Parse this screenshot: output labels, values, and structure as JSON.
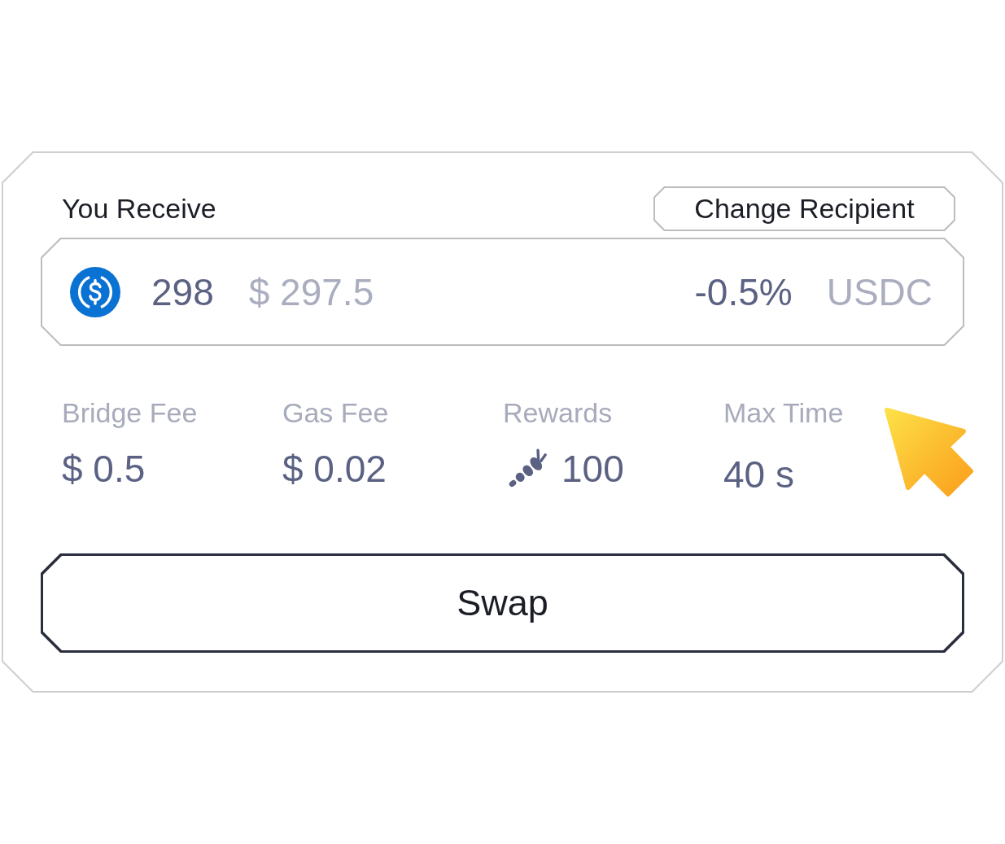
{
  "receive": {
    "label": "You Receive",
    "change_recipient_button": "Change Recipient",
    "amount": "298",
    "usd_value": "$ 297.5",
    "price_impact": "-0.5%",
    "token": "USDC"
  },
  "stats": [
    {
      "kind": "money",
      "label": "Bridge Fee",
      "value": "$ 0.5"
    },
    {
      "kind": "money",
      "label": "Gas Fee",
      "value": "$ 0.02"
    },
    {
      "kind": "reward",
      "label": "Rewards",
      "value": "100"
    },
    {
      "kind": "time",
      "label": "Max Time",
      "value": "40 s"
    }
  ],
  "swap_button": "Swap"
}
